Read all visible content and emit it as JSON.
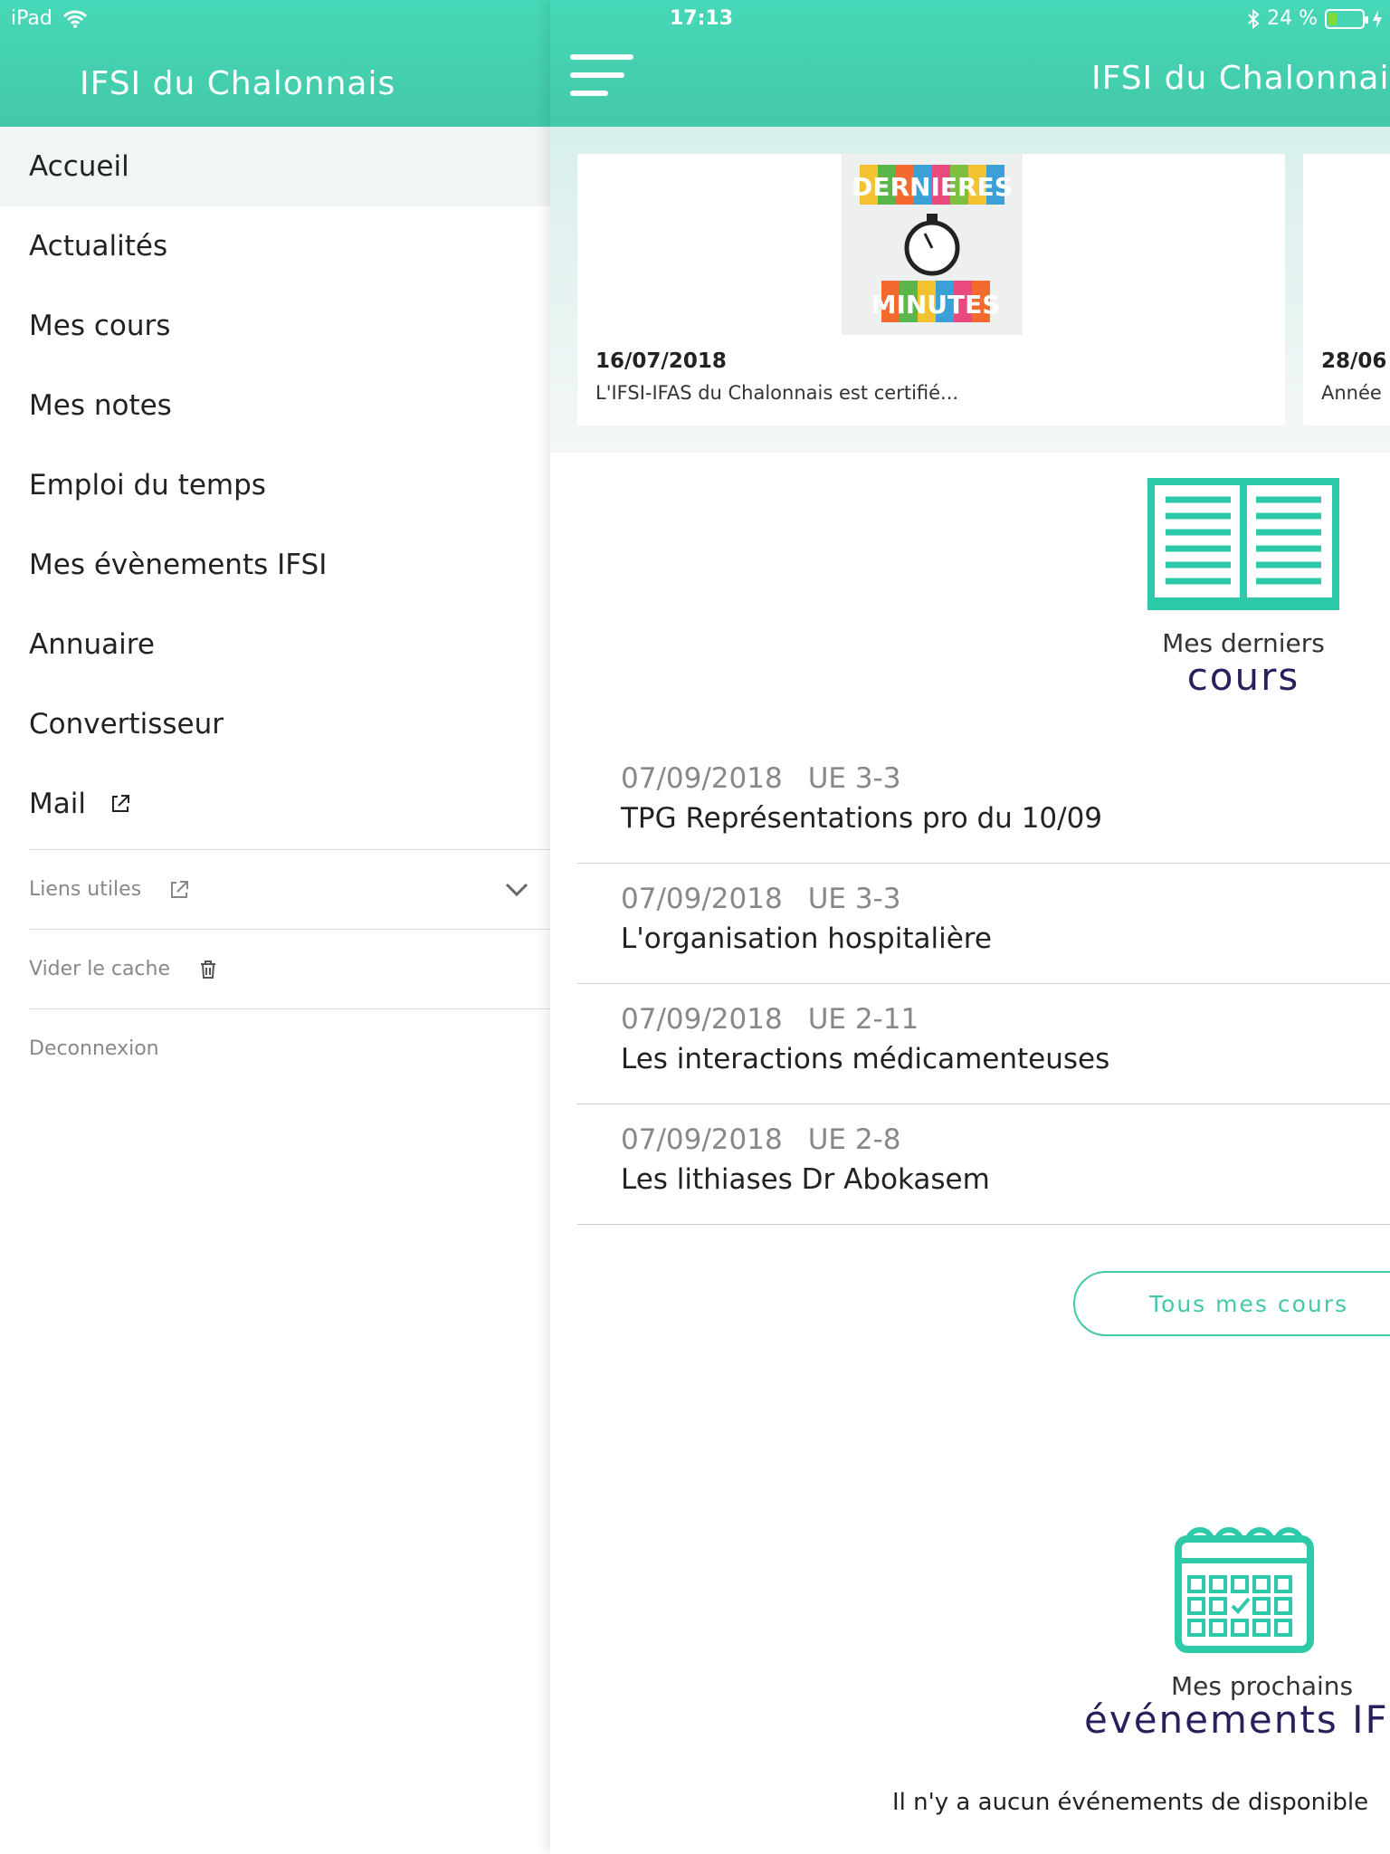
{
  "status_bar": {
    "device": "iPad",
    "time": "17:13",
    "battery": "24 %",
    "battery_level": 0.24
  },
  "sidebar": {
    "title": "IFSI du Chalonnais",
    "items": [
      {
        "label": "Accueil",
        "active": true
      },
      {
        "label": "Actualités"
      },
      {
        "label": "Mes cours"
      },
      {
        "label": "Mes notes"
      },
      {
        "label": "Emploi du temps"
      },
      {
        "label": "Mes évènements IFSI"
      },
      {
        "label": "Annuaire"
      },
      {
        "label": "Convertisseur"
      },
      {
        "label": "Mail",
        "icon": "external-link-icon"
      }
    ],
    "extra": [
      {
        "label": "Liens utiles",
        "icon": "external-link-icon",
        "chevron": "chevron-down-icon"
      },
      {
        "label": "Vider le cache",
        "icon": "trash-icon"
      },
      {
        "label": "Deconnexion"
      }
    ]
  },
  "main": {
    "title": "IFSI du Chalonnais",
    "news": [
      {
        "image_text_top": "DERNIERES",
        "image_text_bottom": "MINUTES",
        "date": "16/07/2018",
        "desc": "L'IFSI-IFAS du Chalonnais est certifié..."
      },
      {
        "date": "28/06",
        "desc": "Année"
      }
    ],
    "courses_section": {
      "small": "Mes derniers",
      "big": "cours"
    },
    "courses": [
      {
        "date": "07/09/2018",
        "ue": "UE 3-3",
        "name": "TPG Représentations pro du 10/09"
      },
      {
        "date": "07/09/2018",
        "ue": "UE 3-3",
        "name": "L'organisation hospitalière"
      },
      {
        "date": "07/09/2018",
        "ue": "UE 2-11",
        "name": "Les interactions médicamenteuses"
      },
      {
        "date": "07/09/2018",
        "ue": "UE 2-8",
        "name": "Les lithiases Dr Abokasem"
      }
    ],
    "all_courses_button": "Tous mes cours",
    "events_section": {
      "small": "Mes prochains",
      "big": "événements IFSI"
    },
    "events_empty": "Il n'y a aucun événements de disponible"
  },
  "colors": {
    "accent": "#43c9a9",
    "title_purple": "#2a1f5c"
  }
}
